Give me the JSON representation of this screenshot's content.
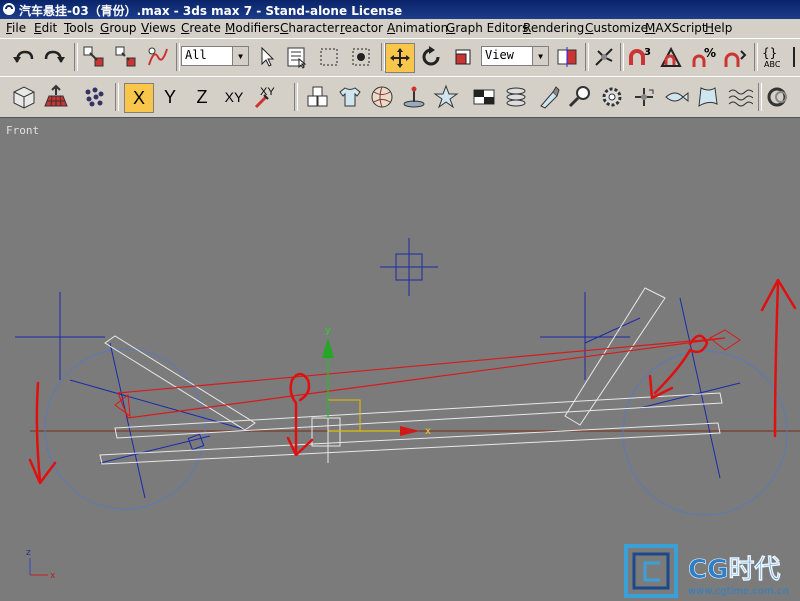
{
  "window": {
    "title": "汽车悬挂-03（青份）.max - 3ds max 7  - Stand-alone License"
  },
  "menu": [
    "File",
    "Edit",
    "Tools",
    "Group",
    "Views",
    "Create",
    "Modifiers",
    "Character",
    "reactor",
    "Animation",
    "Graph Editors",
    "Rendering",
    "Customize",
    "MAXScript",
    "Help"
  ],
  "toolbar": {
    "selection_filter": "All",
    "reference_coord": "View"
  },
  "axis_constraints": {
    "x": "X",
    "y": "Y",
    "z": "Z",
    "xy": "XY",
    "xy2": "XY"
  },
  "viewport": {
    "label": "Front",
    "gizmo_x_label": "x",
    "gizmo_y_label": "y",
    "triad_x": "x",
    "triad_z": "z"
  },
  "watermark": {
    "brand": "CG时代",
    "url": "www.cgtime.com.cn"
  },
  "colors": {
    "titlebar": "#0a246a",
    "viewport_bg": "#7b7b7b",
    "active_button": "#f7c64b",
    "annotation_red": "#e01010"
  }
}
